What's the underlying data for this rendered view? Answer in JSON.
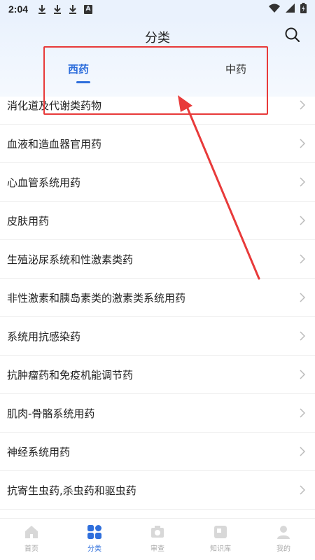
{
  "statusbar": {
    "time": "2:04",
    "sim_label": "A"
  },
  "header": {
    "title": "分类",
    "search_icon": "search-icon"
  },
  "tabs": [
    {
      "label": "西药",
      "active": true
    },
    {
      "label": "中药",
      "active": false
    }
  ],
  "categories": [
    "消化道及代谢类药物",
    "血液和造血器官用药",
    "心血管系统用药",
    "皮肤用药",
    "生殖泌尿系统和性激素类药",
    "非性激素和胰岛素类的激素类系统用药",
    "系统用抗感染药",
    "抗肿瘤药和免疫机能调节药",
    "肌肉-骨骼系统用药",
    "神经系统用药",
    "抗寄生虫药,杀虫药和驱虫药"
  ],
  "bottom_nav": [
    {
      "label": "首页",
      "icon": "home-icon",
      "active": false
    },
    {
      "label": "分类",
      "icon": "grid-icon",
      "active": true
    },
    {
      "label": "审查",
      "icon": "camera-icon",
      "active": false
    },
    {
      "label": "知识库",
      "icon": "book-icon",
      "active": false
    },
    {
      "label": "我的",
      "icon": "user-icon",
      "active": false
    }
  ],
  "colors": {
    "accent": "#2f6fdc",
    "annotation": "#e83a3a",
    "header_bg": "#eaf2fd"
  }
}
